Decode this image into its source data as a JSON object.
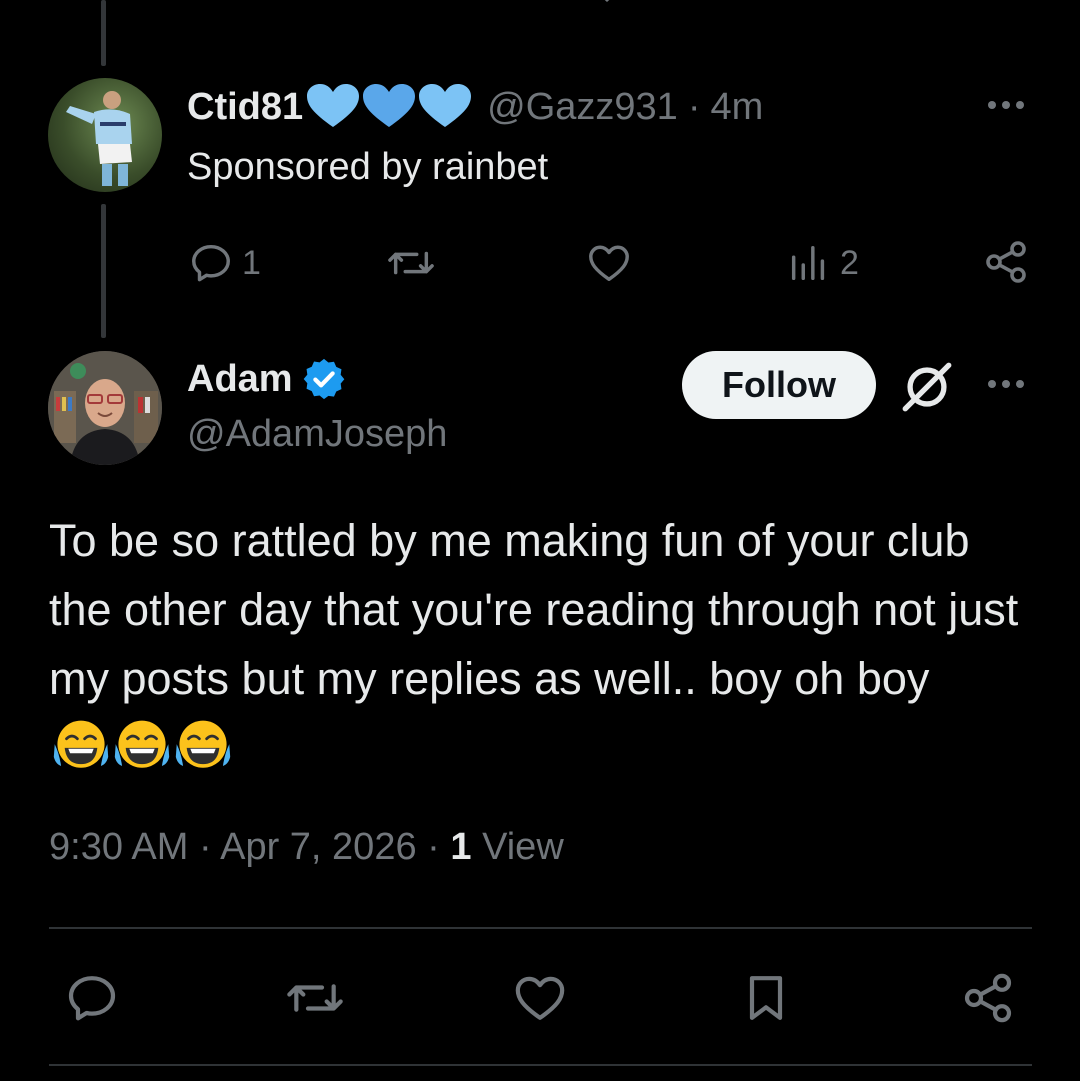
{
  "reply": {
    "display_name": "Ctid81",
    "handle": "@Gazz931",
    "separator": "·",
    "time": "4m",
    "text": "Sponsored by rainbet",
    "counts": {
      "replies": "1",
      "views": "2"
    },
    "heart_badges": [
      "#7cc3f5",
      "#5aa7ea",
      "#7cc3f5"
    ]
  },
  "post": {
    "display_name": "Adam",
    "handle": "@AdamJoseph",
    "follow_label": "Follow",
    "verified_color": "#1d9bf0",
    "text": "To be so rattled by me making fun of your club the other day that you're reading through not just my posts but my replies as well.. boy oh boy",
    "emojis": [
      "face-with-tears-of-joy",
      "face-with-tears-of-joy",
      "face-with-tears-of-joy"
    ],
    "time": "9:30 AM",
    "date": "Apr 7, 2026",
    "sep": "·",
    "views_count": "1",
    "views_label": "View"
  },
  "icons": {
    "reply": "reply-icon",
    "repost": "repost-icon",
    "like": "heart-icon",
    "views": "analytics-icon",
    "share": "share-icon",
    "bookmark": "bookmark-icon",
    "grok": "grok-icon",
    "more": "more-icon"
  },
  "colors": {
    "background": "#000000",
    "text": "#e7e9ea",
    "muted": "#71767b",
    "divider": "#2f3336"
  }
}
